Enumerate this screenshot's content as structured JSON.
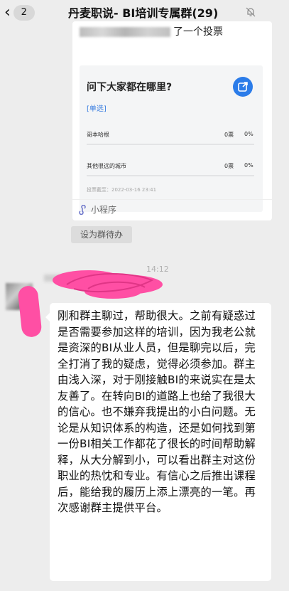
{
  "header": {
    "back_icon": "chevron-left-icon",
    "unread_count": "2",
    "title": "丹麦职说- BI培训专属群(29)",
    "mute_icon": "bell-muted-icon"
  },
  "share_card": {
    "head_suffix": "了一个投票",
    "poll": {
      "question": "问下大家都在哪里?",
      "type": "[单选]",
      "options": [
        {
          "label": "哥本哈根",
          "votes": "0票",
          "pct": "0%"
        },
        {
          "label": "其他很远的城市",
          "votes": "0票",
          "pct": "0%"
        }
      ],
      "deadline": "投票截至：2022-03-16 23:41"
    },
    "mini_program_label": "小程序",
    "mini_program_icon": "mini-program-icon",
    "share_icon": "share-icon"
  },
  "todo_button": "设为群待办",
  "timestamp": "14:12",
  "message": {
    "text": "刚和群主聊过，帮助很大。之前有疑惑过是否需要参加这样的培训，因为我老公就是资深的BI从业人员，但是聊完以后，完全打消了我的疑虑，觉得必须参加。群主由浅入深，对于刚接触BI的来说实在是太友善了。在转向BI的道路上也给了我很大的信心。也不嫌弃我提出的小白问题。无论是从知识体系的构造，还是如何找到第一份BI相关工作都花了很长的时间帮助解释，从大分解到小，可以看出群主对这份职业的热忱和专业。有信心之后推出课程后，能给我的履历上添上漂亮的一笔。再次感谢群主提供平台。"
  },
  "colors": {
    "background": "#ededed",
    "accent_blue": "#2b7ce9",
    "redaction_pink": "#ff4fa4"
  }
}
